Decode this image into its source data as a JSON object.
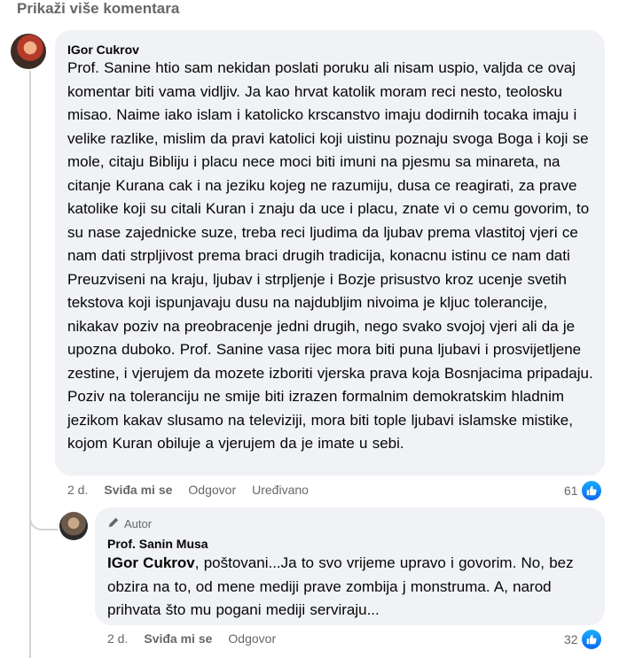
{
  "show_more": "Prikaži više komentara",
  "comments": [
    {
      "author": "IGor Cukrov",
      "text": "Prof. Sanine htio sam nekidan poslati poruku ali nisam uspio, valjda ce ovaj komentar biti vama vidljiv. Ja kao hrvat katolik moram reci nesto, teolosku misao. Naime iako islam i katolicko krscanstvo imaju dodirnih tocaka imaju i velike razlike, mislim da pravi katolici koji uistinu poznaju svoga Boga i koji se mole, citaju Bibliju i placu nece moci biti imuni na pjesmu sa minareta, na citanje Kurana cak i na jeziku kojeg ne razumiju, dusa ce reagirati, za prave katolike koji su citali Kuran i znaju da uce i placu, znate vi o cemu govorim, to su nase zajednicke suze, treba reci ljudima da ljubav prema vlastitoj vjeri ce nam dati strpljivost prema braci drugih tradicija, konacnu istinu ce nam dati Preuzviseni na kraju, ljubav i strpljenje i Bozje prisustvo kroz ucenje svetih tekstova koji ispunjavaju dusu na najdubljim nivoima je kljuc tolerancije, nikakav poziv na preobracenje jedni drugih, nego svako svojoj vjeri ali da je upozna duboko. Prof. Sanine vasa rijec mora biti puna ljubavi i prosvijetljene zestine, i vjerujem da mozete izboriti vjerska prava koja Bosnjacima pripadaju. Poziv na toleranciju ne smije biti izrazen formalnim demokratskim hladnim jezikom kakav slusamo na televiziji, mora biti tople ljubavi islamske mistike, kojom Kuran obiluje a vjerujem da je imate u sebi.",
      "time": "2 d.",
      "like": "Sviđa mi se",
      "reply": "Odgovor",
      "edited": "Uređivano",
      "reactions": "61"
    },
    {
      "badge": "Autor",
      "author": "Prof. Sanin Musa",
      "mention": "IGor Cukrov",
      "text": ", poštovani...Ja to svo vrijeme upravo i govorim. No, bez obzira na to, od mene mediji prave zombija j monstruma. A, narod prihvata što mu pogani mediji serviraju...",
      "time": "2 d.",
      "like": "Sviđa mi se",
      "reply": "Odgovor",
      "reactions": "32"
    }
  ],
  "colors": {
    "accent": "#0866ff",
    "bubble": "#f0f2f5",
    "muted": "#65676b"
  },
  "icons": {
    "reaction": "thumbs-up-icon",
    "author_badge": "pencil-icon"
  }
}
